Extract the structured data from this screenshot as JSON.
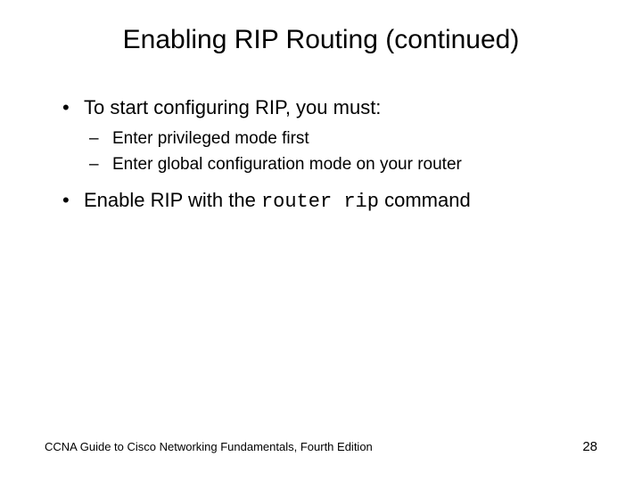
{
  "slide": {
    "title": "Enabling RIP Routing (continued)",
    "bullets": [
      {
        "text": "To start configuring RIP, you must:",
        "children": [
          "Enter privileged mode first",
          "Enter global configuration mode on your router"
        ]
      },
      {
        "prefix": "Enable RIP with the ",
        "code": "router rip",
        "suffix": " command"
      }
    ],
    "footer": "CCNA Guide to Cisco Networking Fundamentals, Fourth Edition",
    "page": "28"
  }
}
